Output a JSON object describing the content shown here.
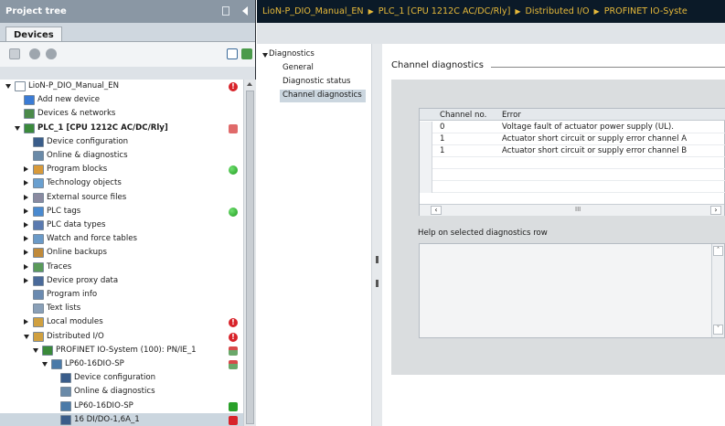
{
  "project_tree": {
    "title": "Project tree",
    "devices_tab": "Devices",
    "items": [
      {
        "label": "LioN-P_DIO_Manual_EN",
        "level": 0,
        "arrow": "down",
        "icon": "project-icon",
        "icon_color": "#ffffff",
        "status": "error"
      },
      {
        "label": "Add new device",
        "level": 1,
        "arrow": "none",
        "icon": "add-device-icon",
        "icon_color": "#3a7bd5",
        "status": ""
      },
      {
        "label": "Devices & networks",
        "level": 1,
        "arrow": "none",
        "icon": "network-icon",
        "icon_color": "#4a8a4a",
        "status": ""
      },
      {
        "label": "PLC_1 [CPU 1212C AC/DC/Rly]",
        "level": 1,
        "arrow": "down",
        "icon": "plc-icon",
        "icon_color": "#3b8a3b",
        "status": "plc",
        "bold": true
      },
      {
        "label": "Device configuration",
        "level": 2,
        "arrow": "none",
        "icon": "device-config-icon",
        "icon_color": "#3a5d8a",
        "status": ""
      },
      {
        "label": "Online & diagnostics",
        "level": 2,
        "arrow": "none",
        "icon": "online-diagnostics-icon",
        "icon_color": "#6a8aa8",
        "status": ""
      },
      {
        "label": "Program blocks",
        "level": 2,
        "arrow": "right",
        "icon": "folder-icon",
        "icon_color": "#d89a3a",
        "status": "ok"
      },
      {
        "label": "Technology objects",
        "level": 2,
        "arrow": "right",
        "icon": "folder-icon",
        "icon_color": "#6aa0d0",
        "status": ""
      },
      {
        "label": "External source files",
        "level": 2,
        "arrow": "right",
        "icon": "folder-icon",
        "icon_color": "#8a8aa0",
        "status": ""
      },
      {
        "label": "PLC tags",
        "level": 2,
        "arrow": "right",
        "icon": "folder-icon",
        "icon_color": "#4a8ad0",
        "status": "ok"
      },
      {
        "label": "PLC data types",
        "level": 2,
        "arrow": "right",
        "icon": "folder-icon",
        "icon_color": "#5a7ab0",
        "status": ""
      },
      {
        "label": "Watch and force tables",
        "level": 2,
        "arrow": "right",
        "icon": "folder-icon",
        "icon_color": "#6a9ac8",
        "status": ""
      },
      {
        "label": "Online backups",
        "level": 2,
        "arrow": "right",
        "icon": "folder-icon",
        "icon_color": "#c08a3a",
        "status": ""
      },
      {
        "label": "Traces",
        "level": 2,
        "arrow": "right",
        "icon": "folder-icon",
        "icon_color": "#5a9a5a",
        "status": ""
      },
      {
        "label": "Device proxy data",
        "level": 2,
        "arrow": "right",
        "icon": "folder-icon",
        "icon_color": "#4a6a9a",
        "status": ""
      },
      {
        "label": "Program info",
        "level": 2,
        "arrow": "none",
        "icon": "program-info-icon",
        "icon_color": "#6a8ab0",
        "status": ""
      },
      {
        "label": "Text lists",
        "level": 2,
        "arrow": "none",
        "icon": "text-list-icon",
        "icon_color": "#8aa0b8",
        "status": ""
      },
      {
        "label": "Local modules",
        "level": 2,
        "arrow": "right",
        "icon": "folder-icon",
        "icon_color": "#d0a040",
        "status": "error"
      },
      {
        "label": "Distributed I/O",
        "level": 2,
        "arrow": "down",
        "icon": "folder-icon",
        "icon_color": "#d0a040",
        "status": "error"
      },
      {
        "label": "PROFINET IO-System (100): PN/IE_1",
        "level": 3,
        "arrow": "down",
        "icon": "profinet-icon",
        "icon_color": "#3a8a3a",
        "status": "sq-warn"
      },
      {
        "label": "LP60-16DIO-SP",
        "level": 4,
        "arrow": "down",
        "icon": "module-icon",
        "icon_color": "#4a7aa8",
        "status": "sq-warn"
      },
      {
        "label": "Device configuration",
        "level": 5,
        "arrow": "none",
        "icon": "device-config-icon",
        "icon_color": "#3a5d8a",
        "status": ""
      },
      {
        "label": "Online & diagnostics",
        "level": 5,
        "arrow": "none",
        "icon": "online-diagnostics-icon",
        "icon_color": "#6a8aa8",
        "status": ""
      },
      {
        "label": "LP60-16DIO-SP",
        "level": 5,
        "arrow": "none",
        "icon": "module-icon",
        "icon_color": "#4a7aa8",
        "status": "sq-ok"
      },
      {
        "label": "16 DI/DO-1,6A_1",
        "level": 5,
        "arrow": "none",
        "icon": "io-module-icon",
        "icon_color": "#3a5d8a",
        "status": "sq-err",
        "selected": true
      }
    ]
  },
  "breadcrumb": [
    "LioN-P_DIO_Manual_EN",
    "PLC_1 [CPU 1212C AC/DC/Rly]",
    "Distributed I/O",
    "PROFINET IO-Syste"
  ],
  "nav": {
    "diagnostics": "Diagnostics",
    "general": "General",
    "diagnostic_status": "Diagnostic status",
    "channel_diagnostics": "Channel diagnostics"
  },
  "channel_diagnostics": {
    "title": "Channel diagnostics",
    "columns": [
      "Channel no.",
      "Error"
    ],
    "rows": [
      {
        "channel": "0",
        "error": "Voltage fault of actuator power supply (UL)."
      },
      {
        "channel": "1",
        "error": "Actuator short circuit or supply error channel A"
      },
      {
        "channel": "1",
        "error": "Actuator short circuit or supply error channel B"
      }
    ],
    "scroll_mid": "III",
    "help_label": "Help on selected diagnostics row"
  }
}
